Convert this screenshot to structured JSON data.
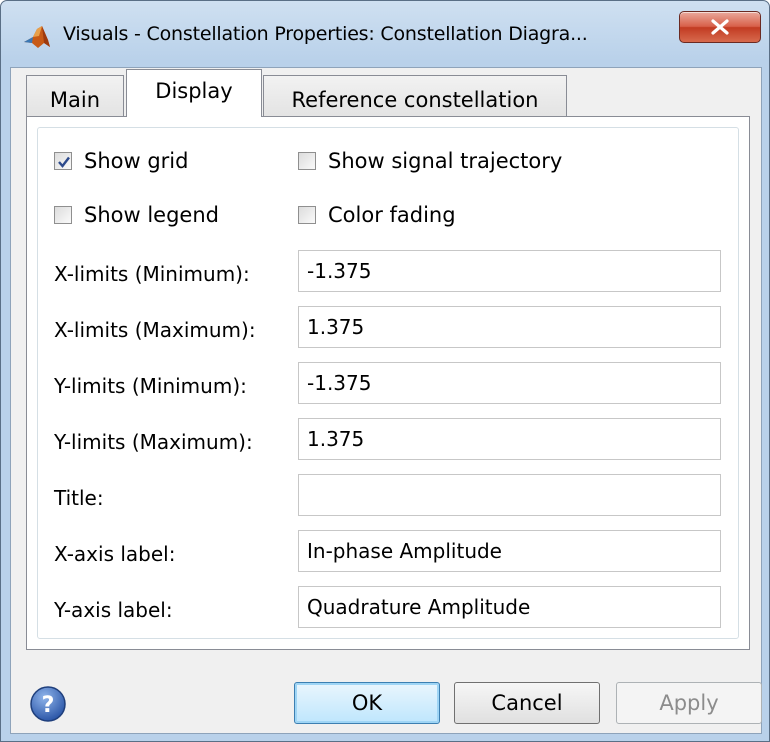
{
  "window": {
    "title": "Visuals - Constellation Properties: Constellation Diagra...",
    "icon": "matlab-logo-icon",
    "close_icon": "close-icon"
  },
  "tabs": [
    {
      "label": "Main"
    },
    {
      "label": "Display",
      "selected": true
    },
    {
      "label": "Reference constellation"
    }
  ],
  "display": {
    "show_grid": {
      "label": "Show grid",
      "checked": true
    },
    "show_signal_trajectory": {
      "label": "Show signal trajectory",
      "checked": false
    },
    "show_legend": {
      "label": "Show legend",
      "checked": false
    },
    "color_fading": {
      "label": "Color fading",
      "checked": false
    },
    "xlim_min": {
      "label": "X-limits (Minimum):",
      "value": "-1.375"
    },
    "xlim_max": {
      "label": "X-limits (Maximum):",
      "value": "1.375"
    },
    "ylim_min": {
      "label": "Y-limits (Minimum):",
      "value": "-1.375"
    },
    "ylim_max": {
      "label": "Y-limits (Maximum):",
      "value": "1.375"
    },
    "title": {
      "label": "Title:",
      "value": ""
    },
    "xaxis_label": {
      "label": "X-axis label:",
      "value": "In-phase Amplitude"
    },
    "yaxis_label": {
      "label": "Y-axis label:",
      "value": "Quadrature Amplitude"
    }
  },
  "buttons": {
    "help_icon": "help-icon",
    "ok": "OK",
    "cancel": "Cancel",
    "apply": "Apply"
  }
}
